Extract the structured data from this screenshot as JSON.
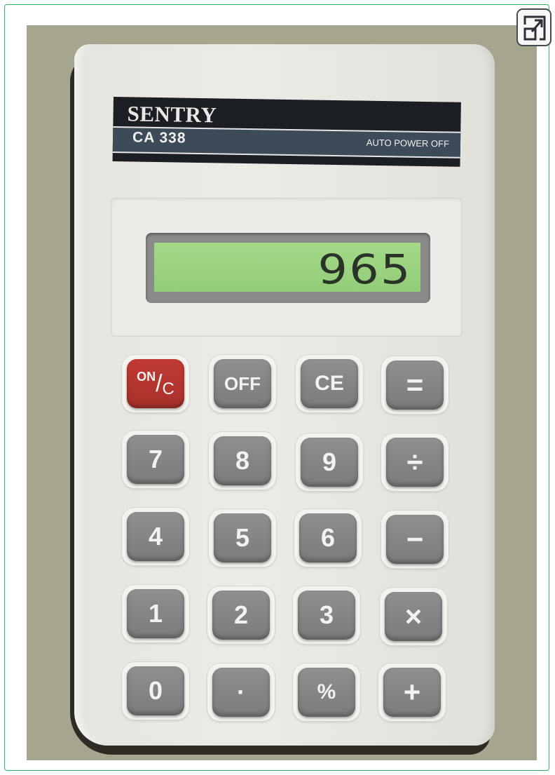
{
  "calculator": {
    "brand": "SENTRY",
    "model": "CA 338",
    "feature_label": "AUTO POWER OFF",
    "display_value": "965"
  },
  "toolbar": {
    "fullscreen_icon": "expand-icon"
  },
  "keys": {
    "on_c": {
      "top": "ON",
      "slash": "/",
      "bottom": "C"
    },
    "off": "OFF",
    "ce": "CE",
    "equals": "=",
    "seven": "7",
    "eight": "8",
    "nine": "9",
    "divide": "÷",
    "four": "4",
    "five": "5",
    "six": "6",
    "minus": "−",
    "one": "1",
    "two": "2",
    "three": "3",
    "multiply": "×",
    "zero": "0",
    "decimal": "·",
    "percent": "%",
    "plus": "+"
  },
  "colors": {
    "on_key": "#b8332e",
    "key_grey": "#868684",
    "lcd_green": "#9ad47e",
    "frame_border": "#2fb36a"
  }
}
